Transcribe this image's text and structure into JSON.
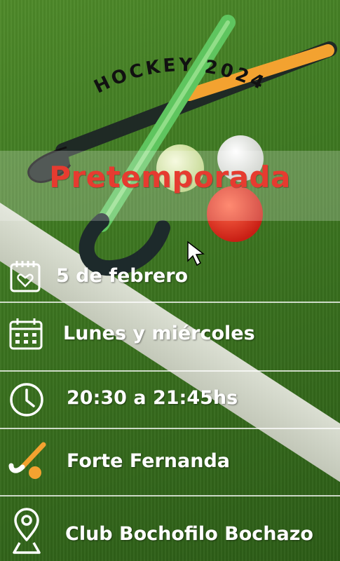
{
  "poster": {
    "arc_title": "HOCKEY 2024",
    "subtitle": "Pretemporada",
    "accent_color": "#e63b30",
    "items": [
      {
        "icon": "calendar-heart-icon",
        "text": "5 de febrero"
      },
      {
        "icon": "calendar-grid-icon",
        "text": "Lunes y miércoles"
      },
      {
        "icon": "clock-icon",
        "text": "20:30 a 21:45hs"
      },
      {
        "icon": "hockey-stick-icon",
        "text": "Forte Fernanda"
      },
      {
        "icon": "location-pin-icon",
        "text": "Club Bochofilo Bochazo"
      }
    ]
  }
}
